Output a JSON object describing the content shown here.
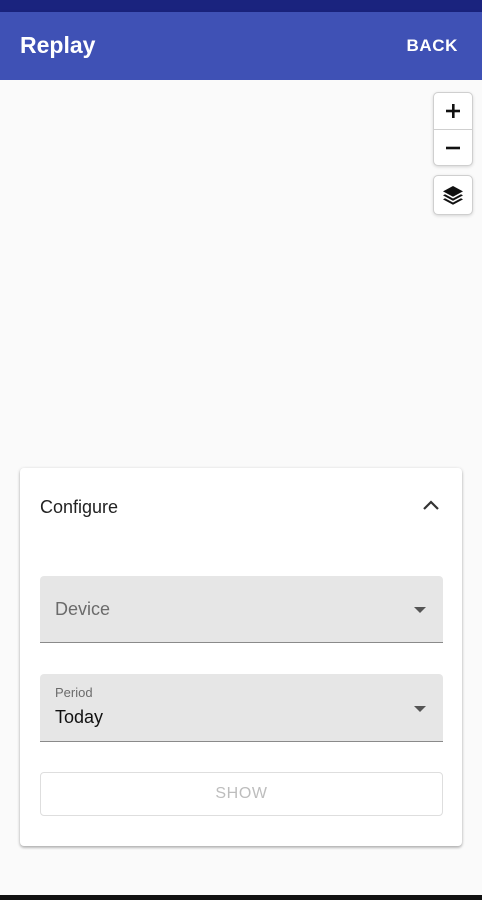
{
  "appbar": {
    "title": "Replay",
    "back_label": "BACK"
  },
  "map": {
    "zoom_in_icon": "plus-icon",
    "zoom_out_icon": "minus-icon",
    "layers_icon": "layers-icon"
  },
  "panel": {
    "title": "Configure",
    "collapse_icon": "chevron-up-icon",
    "device": {
      "placeholder": "Device",
      "value": ""
    },
    "period": {
      "label": "Period",
      "value": "Today"
    },
    "show_label": "SHOW"
  },
  "colors": {
    "primary": "#3f51b5",
    "status_bar": "#1a237e",
    "field_bg": "#e6e6e6"
  }
}
